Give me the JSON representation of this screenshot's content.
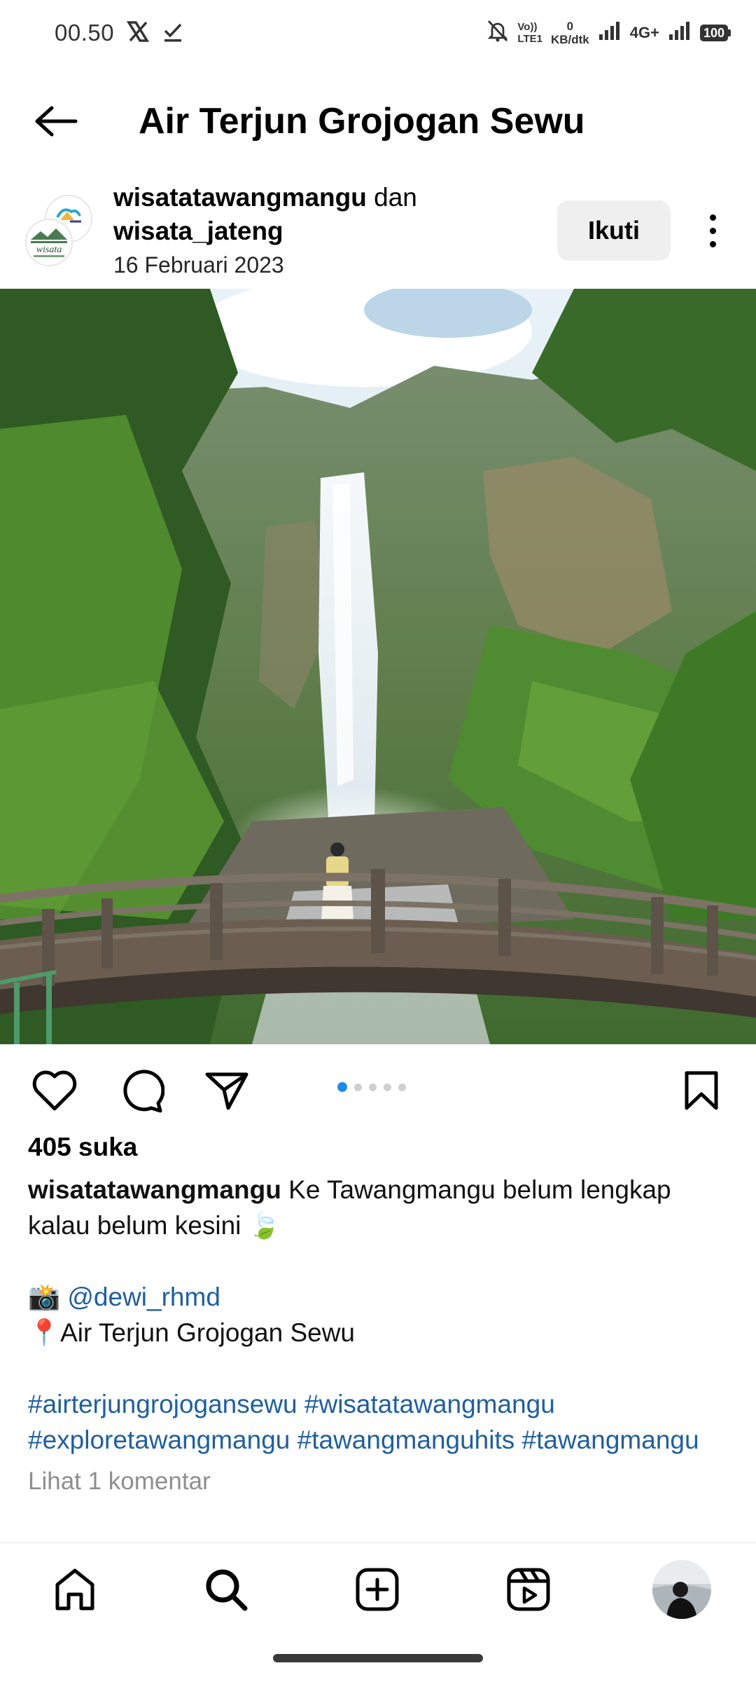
{
  "status_bar": {
    "time": "00.50",
    "data_rate_value": "0",
    "data_rate_unit": "KB/dtk",
    "volte_line1": "Vo))",
    "volte_line2": "LTE1",
    "network": "4G+",
    "battery": "100"
  },
  "header": {
    "title": "Air Terjun Grojogan Sewu",
    "back_icon": "arrow-left-icon"
  },
  "post": {
    "author1": "wisatatawangmangu",
    "conjunction": " dan ",
    "author2": "wisata_jateng",
    "date": "16 Februari 2023",
    "avatar2_text": "wisata",
    "follow_label": "Ikuti",
    "likes": "405 suka",
    "caption": {
      "user": "wisatatawangmangu",
      "text": " Ke Tawangmangu belum lengkap kalau belum kesini 🍃",
      "camera_emoji": "📸",
      "mention": "@dewi_rhmd",
      "pin_emoji": "📍",
      "location": "Air Terjun Grojogan Sewu",
      "hashtags_line1": "#airterjungrojogansewu #wisatatawangmangu",
      "hashtags_line2": "#exploretawangmangu #tawangmanguhits #tawangmangu"
    },
    "comments_link": "Lihat 1 komentar",
    "carousel": {
      "count": 5,
      "active": 1
    }
  },
  "colors": {
    "link": "#1f5f9e",
    "carousel_active": "#1a8cf0",
    "muted": "#8e8e8e"
  }
}
